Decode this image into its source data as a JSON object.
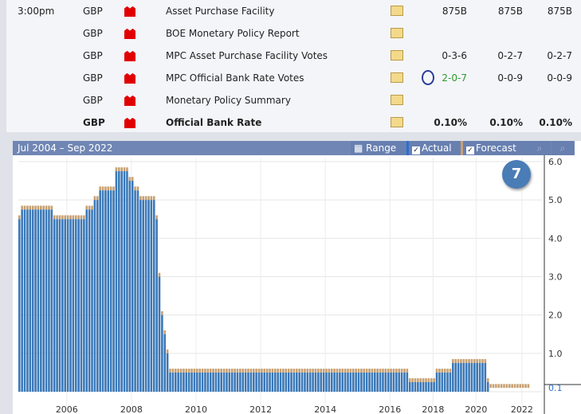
{
  "table": {
    "rows": [
      {
        "time": "3:00pm",
        "currency": "GBP",
        "event": "Asset Purchase Facility",
        "actual": "875B",
        "forecast": "875B",
        "previous": "875B",
        "bold": false
      },
      {
        "time": "",
        "currency": "GBP",
        "event": "BOE Monetary Policy Report",
        "actual": "",
        "forecast": "",
        "previous": "",
        "bold": false
      },
      {
        "time": "",
        "currency": "GBP",
        "event": "MPC Asset Purchase Facility Votes",
        "actual": "0-3-6",
        "forecast": "0-2-7",
        "previous": "0-2-7",
        "bold": false
      },
      {
        "time": "",
        "currency": "GBP",
        "event": "MPC Official Bank Rate Votes",
        "actual": "2-0-7",
        "forecast": "0-0-9",
        "previous": "0-0-9",
        "bold": false
      },
      {
        "time": "",
        "currency": "GBP",
        "event": "Monetary Policy Summary",
        "actual": "",
        "forecast": "",
        "previous": "",
        "bold": false
      },
      {
        "time": "",
        "currency": "GBP",
        "event": "Official Bank Rate",
        "actual": "0.10%",
        "forecast": "0.10%",
        "previous": "0.10%",
        "bold": true
      }
    ],
    "icons": {
      "impact": "red-flag-icon",
      "detail": "document-icon"
    }
  },
  "chart_header": {
    "range_text": "Jul 2004 – Sep 2022",
    "range_button": "Range",
    "actual_label": "Actual",
    "forecast_label": "Forecast",
    "actual_checked": true,
    "forecast_checked": true
  },
  "annotation": "7",
  "chart_data": {
    "type": "bar",
    "ylim": [
      0,
      6
    ],
    "y_ticks": [
      "6.0",
      "5.0",
      "4.0",
      "3.0",
      "2.0",
      "1.0",
      "0.0"
    ],
    "x_ticks": [
      "2006",
      "2008",
      "2010",
      "2012",
      "2014",
      "2016",
      "2018",
      "2020",
      "2022"
    ],
    "current_value_label": "0.1",
    "colors": {
      "actual": "#3a78b8",
      "forecast": "#c8a070"
    },
    "runs": [
      {
        "value": 4.5,
        "count": 1
      },
      {
        "value": 4.75,
        "count": 12
      },
      {
        "value": 4.5,
        "count": 12
      },
      {
        "value": 4.75,
        "count": 3
      },
      {
        "value": 5.0,
        "count": 2
      },
      {
        "value": 5.25,
        "count": 6
      },
      {
        "value": 5.75,
        "count": 5
      },
      {
        "value": 5.5,
        "count": 2
      },
      {
        "value": 5.25,
        "count": 2
      },
      {
        "value": 5.0,
        "count": 6
      },
      {
        "value": 4.5,
        "count": 1
      },
      {
        "value": 3.0,
        "count": 1
      },
      {
        "value": 2.0,
        "count": 1
      },
      {
        "value": 1.5,
        "count": 1
      },
      {
        "value": 1.0,
        "count": 1
      },
      {
        "value": 0.5,
        "count": 89
      },
      {
        "value": 0.25,
        "count": 10
      },
      {
        "value": 0.5,
        "count": 6
      },
      {
        "value": 0.75,
        "count": 13
      },
      {
        "value": 0.25,
        "count": 1
      },
      {
        "value": 0.1,
        "count": 15
      }
    ]
  }
}
